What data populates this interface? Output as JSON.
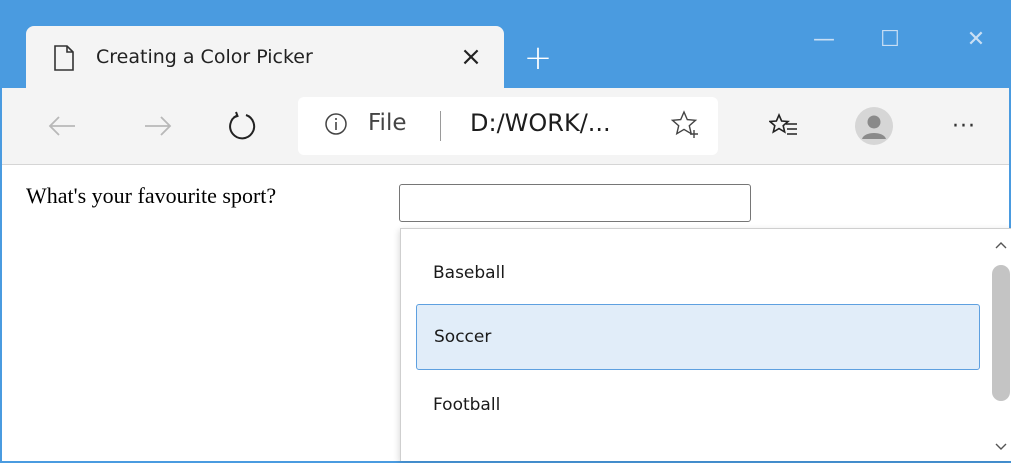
{
  "browser": {
    "tab_title": "Creating a Color Picker",
    "tab_close_glyph": "×",
    "new_tab_glyph": "+",
    "window_controls": {
      "minimize": "—",
      "maximize": "☐",
      "close": "✕"
    },
    "nav": {
      "back_glyph": "←",
      "forward_glyph": "→",
      "refresh_glyph": "↻"
    },
    "address": {
      "scheme_label": "File",
      "url": "D:/WORK/..."
    },
    "toolbar_more": "···",
    "icons": [
      "page-icon",
      "info-icon",
      "star-icon",
      "favorites-icon",
      "profile-icon"
    ]
  },
  "page": {
    "question": "What's your favourite sport?",
    "input_value": "",
    "options": [
      "Baseball",
      "Soccer",
      "Football"
    ],
    "selected_option": "Soccer"
  },
  "colors": {
    "titlebar": "#4a9be0",
    "toolbar": "#f4f4f4",
    "selected_bg": "#e1edf9",
    "selected_border": "#5ea0e0"
  }
}
